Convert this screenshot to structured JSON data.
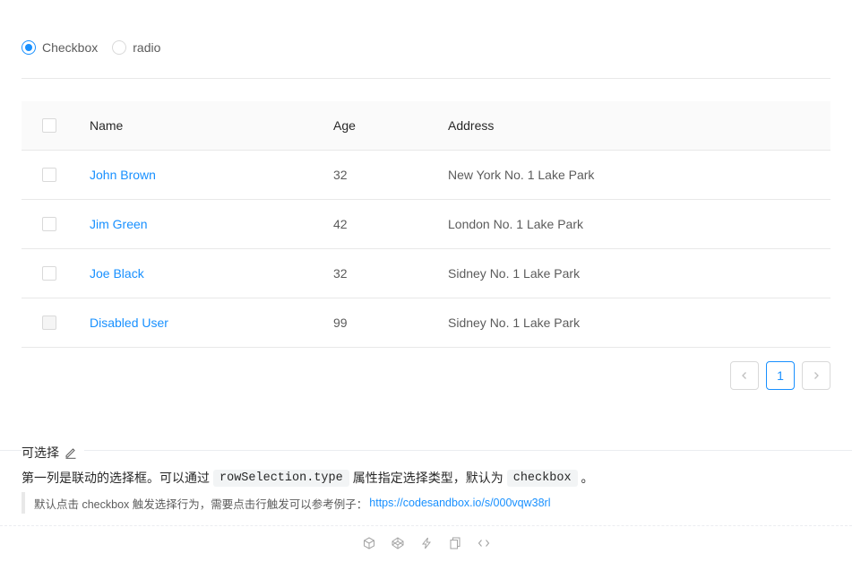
{
  "selection_type": {
    "options": [
      {
        "label": "Checkbox",
        "checked": true
      },
      {
        "label": "radio",
        "checked": false
      }
    ]
  },
  "table": {
    "columns": [
      "Name",
      "Age",
      "Address"
    ],
    "rows": [
      {
        "name": "John Brown",
        "age": "32",
        "address": "New York No. 1 Lake Park",
        "disabled": false
      },
      {
        "name": "Jim Green",
        "age": "42",
        "address": "London No. 1 Lake Park",
        "disabled": false
      },
      {
        "name": "Joe Black",
        "age": "32",
        "address": "Sidney No. 1 Lake Park",
        "disabled": false
      },
      {
        "name": "Disabled User",
        "age": "99",
        "address": "Sidney No. 1 Lake Park",
        "disabled": true
      }
    ]
  },
  "pagination": {
    "current": "1",
    "prev_icon": "chevron-left-icon",
    "next_icon": "chevron-right-icon"
  },
  "demo": {
    "title": "可选择",
    "desc_part1": "第一列是联动的选择框。可以通过",
    "desc_code1": "rowSelection.type",
    "desc_part2": "属性指定选择类型，默认为",
    "desc_code2": "checkbox",
    "desc_part3": "。",
    "quote_text": "默认点击 checkbox 触发选择行为，需要点击行触发可以参考例子：",
    "quote_link": "https://codesandbox.io/s/000vqw38rl"
  },
  "colors": {
    "primary": "#1890ff",
    "border": "#e8e8e8",
    "header_bg": "#fafafa"
  }
}
